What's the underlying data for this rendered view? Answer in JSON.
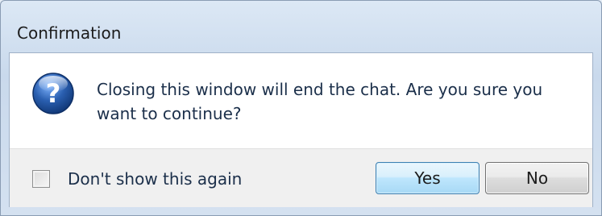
{
  "window": {
    "title": "Confirmation"
  },
  "dialog": {
    "icon": "question-icon",
    "message": "Closing this window will end the chat. Are you sure you want to continue?"
  },
  "footer": {
    "checkbox_label": "Don't show this again",
    "checkbox_checked": false,
    "yes_label": "Yes",
    "no_label": "No"
  },
  "colors": {
    "default_button_border": "#3c7fb1",
    "question_icon_fill": "#2a5fb0",
    "text": "#1b2f4a"
  }
}
